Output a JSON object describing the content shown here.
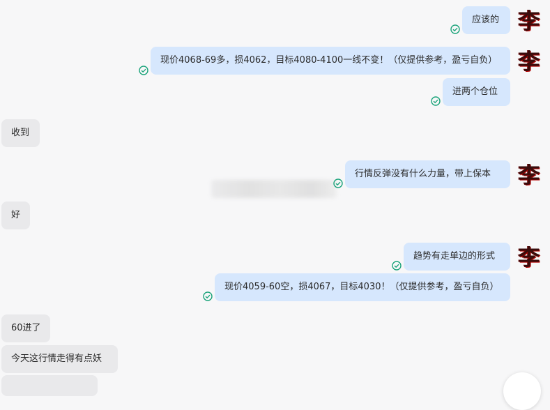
{
  "avatar_char": "李",
  "messages": [
    {
      "text": "应该的",
      "side": "out"
    },
    {
      "text": "现价4068-69多，损4062，目标4080-4100一线不变！（仅提供参考，盈亏自负）",
      "side": "out"
    },
    {
      "text": "进两个仓位",
      "side": "out"
    },
    {
      "text": "收到",
      "side": "in"
    },
    {
      "text": "行情反弹没有什么力量，带上保本",
      "side": "out"
    },
    {
      "text": "好",
      "side": "in"
    },
    {
      "text": "趋势有走单边的形式",
      "side": "out"
    },
    {
      "text": "现价4059-60空，损4067，目标4030！（仅提供参考，盈亏自负）",
      "side": "out"
    },
    {
      "text": "60进了",
      "side": "in"
    },
    {
      "text": "今天这行情走得有点妖",
      "side": "in"
    }
  ],
  "colors": {
    "outgoing_bubble": "#d6e7fd",
    "incoming_bubble": "#e9e9eb",
    "read_check": "#1aa37a",
    "background": "#f7f7f8"
  },
  "icons": {
    "read_receipt": "check-circle-icon",
    "scroll": "scroll-down-button"
  }
}
